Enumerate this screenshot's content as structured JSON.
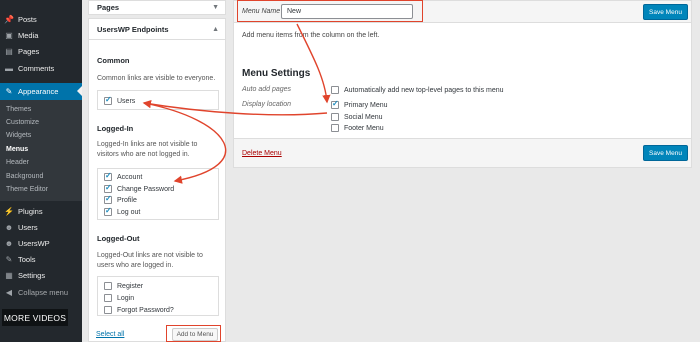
{
  "sidebar": {
    "items": [
      {
        "label": "Posts",
        "icon": "pushpin-icon",
        "glyph": "📌"
      },
      {
        "label": "Media",
        "icon": "media-icon",
        "glyph": "▣"
      },
      {
        "label": "Pages",
        "icon": "pages-icon",
        "glyph": "▤"
      },
      {
        "label": "Comments",
        "icon": "comments-icon",
        "glyph": "▬"
      },
      {
        "label": "Appearance",
        "icon": "brush-icon",
        "glyph": "✎"
      },
      {
        "label": "Plugins",
        "icon": "plugin-icon",
        "glyph": "⚡"
      },
      {
        "label": "Users",
        "icon": "users-icon",
        "glyph": "☻"
      },
      {
        "label": "UsersWP",
        "icon": "userswp-icon",
        "glyph": "☻"
      },
      {
        "label": "Tools",
        "icon": "wrench-icon",
        "glyph": "✎"
      },
      {
        "label": "Settings",
        "icon": "settings-icon",
        "glyph": "▦"
      },
      {
        "label": "Collapse menu",
        "icon": "collapse-icon",
        "glyph": "◀"
      }
    ],
    "submenu": [
      "Themes",
      "Customize",
      "Widgets",
      "Menus",
      "Header",
      "Background",
      "Theme Editor"
    ],
    "current_submenu": "Menus"
  },
  "overlay": {
    "more_videos": "MORE VIDEOS"
  },
  "accordion": {
    "pages_title": "Pages",
    "endpoints_title": "UsersWP Endpoints",
    "common_title": "Common",
    "common_desc": "Common links are visible to everyone.",
    "common_items": [
      {
        "label": "Users",
        "checked": true
      }
    ],
    "loggedin_title": "Logged-In",
    "loggedin_desc": "Logged-In links are not visible to visitors who are not logged in.",
    "loggedin_items": [
      {
        "label": "Account",
        "checked": true
      },
      {
        "label": "Change Password",
        "checked": true
      },
      {
        "label": "Profile",
        "checked": true
      },
      {
        "label": "Log out",
        "checked": true
      }
    ],
    "loggedout_title": "Logged-Out",
    "loggedout_desc": "Logged-Out links are not visible to users who are logged in.",
    "loggedout_items": [
      {
        "label": "Register",
        "checked": false
      },
      {
        "label": "Login",
        "checked": false
      },
      {
        "label": "Forgot Password?",
        "checked": false
      }
    ],
    "select_all": "Select all",
    "add_to_menu": "Add to Menu"
  },
  "editor": {
    "menu_name_label": "Menu Name",
    "menu_name_value": "New",
    "save_menu": "Save Menu",
    "instructions": "Add menu items from the column on the left.",
    "settings_title": "Menu Settings",
    "auto_add_label": "Auto add pages",
    "auto_add_option": "Automatically add new top-level pages to this menu",
    "display_location_label": "Display location",
    "locations": [
      {
        "label": "Primary Menu",
        "checked": true
      },
      {
        "label": "Social Menu",
        "checked": false
      },
      {
        "label": "Footer Menu",
        "checked": false
      }
    ],
    "delete_menu": "Delete Menu"
  },
  "colors": {
    "sidebar_bg": "#23282d",
    "accent": "#0073aa",
    "button_primary": "#0085ba",
    "annotation": "#e0442c"
  }
}
